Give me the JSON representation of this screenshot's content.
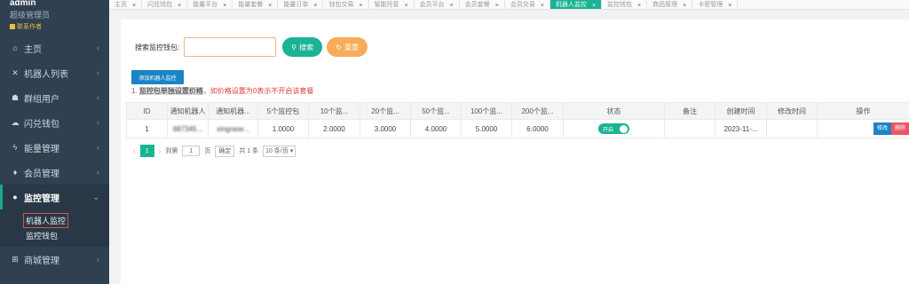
{
  "profile": {
    "name": "admin",
    "role": "超级管理员",
    "contact": "联系作者"
  },
  "sidebar": {
    "items": [
      {
        "label": "主页",
        "icon": "home-icon",
        "glyph": "⌂"
      },
      {
        "label": "机器人列表",
        "icon": "robot-icon",
        "glyph": "✕"
      },
      {
        "label": "群组用户",
        "icon": "users-icon",
        "glyph": "☗"
      },
      {
        "label": "闪兑钱包",
        "icon": "cloud-icon",
        "glyph": "☁"
      },
      {
        "label": "能量管理",
        "icon": "bolt-icon",
        "glyph": "ϟ"
      },
      {
        "label": "会员管理",
        "icon": "diamond-icon",
        "glyph": "♦"
      },
      {
        "label": "监控管理",
        "icon": "monitor-icon",
        "glyph": "●"
      },
      {
        "label": "商城管理",
        "icon": "cart-icon",
        "glyph": "⊞"
      }
    ],
    "sub_items": [
      {
        "label": "机器人监控"
      },
      {
        "label": "监控钱包"
      }
    ]
  },
  "tabs": [
    {
      "label": "主页"
    },
    {
      "label": "闪兑钱包"
    },
    {
      "label": "能量平台"
    },
    {
      "label": "能量套餐"
    },
    {
      "label": "能量订单"
    },
    {
      "label": "钱包交易"
    },
    {
      "label": "智能托管"
    },
    {
      "label": "会员平台"
    },
    {
      "label": "会员套餐"
    },
    {
      "label": "会员交易"
    },
    {
      "label": "机器人监控"
    },
    {
      "label": "监控钱包"
    },
    {
      "label": "商品管理"
    },
    {
      "label": "卡密管理"
    }
  ],
  "search": {
    "label": "搜索监控钱包:",
    "value": "",
    "search_button": "搜索",
    "reset_button": "重置"
  },
  "add_button": "添加机器人监控",
  "tip": {
    "prefix": "1. ",
    "highlight": "监控包单独设置价格",
    "rest": "，如价格设置为0表示不开启该套餐"
  },
  "table": {
    "headers": [
      "ID",
      "通知机器人",
      "通知机器...",
      "5个监控包",
      "10个监...",
      "20个监...",
      "50个监...",
      "100个监...",
      "200个监...",
      "状态",
      "备注",
      "创建时间",
      "修改时间",
      "操作"
    ],
    "rows": [
      {
        "id": "1",
        "bot": "687345...",
        "bot2": "xingrase...",
        "p5": "1.0000",
        "p10": "2.0000",
        "p20": "3.0000",
        "p50": "4.0000",
        "p100": "5.0000",
        "p200": "6.0000",
        "status": "开启",
        "note": "",
        "created": "2023-11-...",
        "modified": "",
        "edit": "修改",
        "delete": "删除"
      }
    ]
  },
  "pager": {
    "prev": "‹",
    "page": "1",
    "next": "›",
    "goto": "到第",
    "goto_value": "1",
    "page_unit": "页",
    "confirm": "确定",
    "total": "共 1 条",
    "page_size": "10 条/页 ▾"
  },
  "colors": {
    "accent": "#1ab394",
    "sidebar": "#2f4050",
    "primary": "#1c84c6",
    "warning": "#f8ac59",
    "danger": "#ed5565"
  }
}
